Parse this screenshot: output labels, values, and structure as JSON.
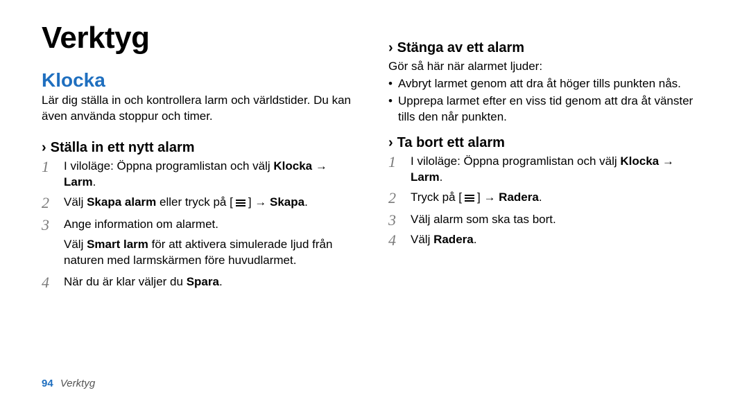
{
  "title": "Verktyg",
  "section": "Klocka",
  "lead": "Lär dig ställa in och kontrollera larm och världstider. Du kan även använda stoppur och timer.",
  "left": {
    "sub_heading": "Ställa in ett nytt alarm",
    "steps": [
      {
        "no": "1",
        "pre": "I viloläge: Öppna programlistan och välj ",
        "bold1": "Klocka",
        "arrow": " → ",
        "bold2": "Larm",
        "post": "."
      },
      {
        "no": "2",
        "pre": "Välj ",
        "bold1": "Skapa alarm",
        "mid": " eller tryck på [",
        "icon": "menu",
        "post_bracket": "] → ",
        "bold2": "Skapa",
        "post": "."
      },
      {
        "no": "3",
        "text": "Ange information om alarmet."
      },
      {
        "no": "4",
        "pre": "När du är klar väljer du ",
        "bold1": "Spara",
        "post": "."
      }
    ],
    "note_pre": "Välj ",
    "note_bold": "Smart larm",
    "note_post": " för att aktivera simulerade ljud från naturen med larmskärmen före huvudlarmet."
  },
  "right": {
    "sub1_heading": "Stänga av ett alarm",
    "sub1_intro": "Gör så här när alarmet ljuder:",
    "sub1_bullets": [
      "Avbryt larmet genom att dra       åt höger tills punkten nås.",
      "Upprepa larmet efter en viss tid genom att dra       åt vänster tills den når punkten."
    ],
    "sub2_heading": "Ta bort ett alarm",
    "sub2_steps": [
      {
        "no": "1",
        "pre": "I viloläge: Öppna programlistan och välj ",
        "bold1": "Klocka",
        "arrow": " → ",
        "bold2": "Larm",
        "post": "."
      },
      {
        "no": "2",
        "pre": "Tryck på [",
        "icon": "menu",
        "post_bracket": "] → ",
        "bold1": "Radera",
        "post": "."
      },
      {
        "no": "3",
        "text": "Välj alarm som ska tas bort."
      },
      {
        "no": "4",
        "pre": "Välj ",
        "bold1": "Radera",
        "post": "."
      }
    ]
  },
  "footer": {
    "page_number": "94",
    "footer_title": "Verktyg"
  },
  "glyphs": {
    "chevron": "›"
  }
}
